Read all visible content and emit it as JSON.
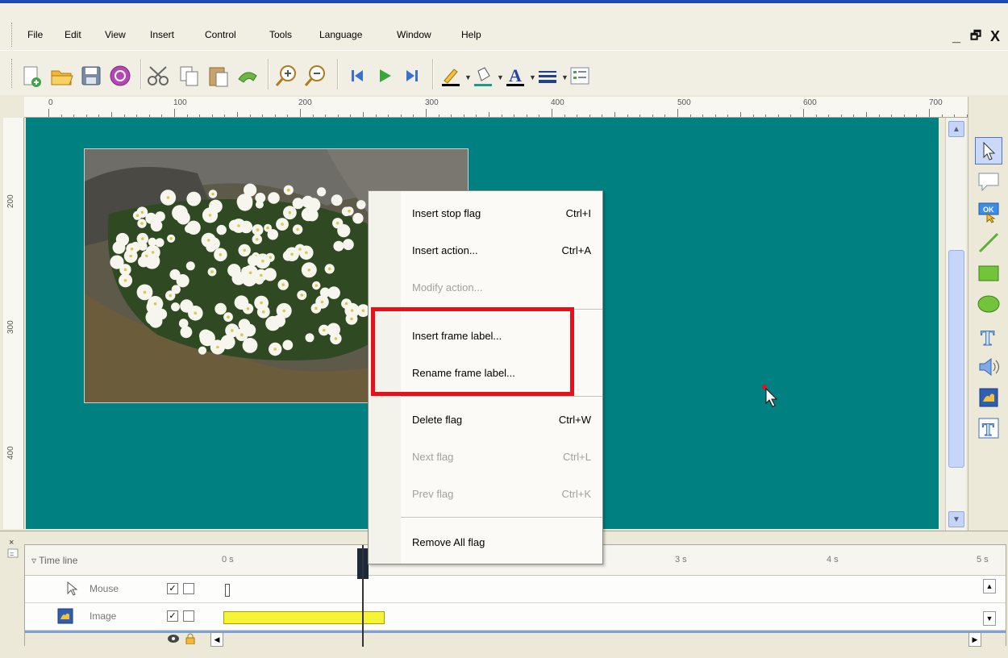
{
  "menubar": {
    "items": [
      "File",
      "Edit",
      "View",
      "Insert",
      "Control",
      "Tools",
      "Language",
      "Window",
      "Help"
    ],
    "window_controls": [
      "_",
      "🗗",
      "X"
    ]
  },
  "toolbar": {
    "icons": [
      "new-file-icon",
      "open-folder-icon",
      "save-icon",
      "publish-icon",
      "cut-icon",
      "copy-icon",
      "paste-icon",
      "undo-icon",
      "zoom-in-icon",
      "zoom-out-icon",
      "first-frame-icon",
      "play-icon",
      "last-frame-icon",
      "line-color-icon",
      "fill-color-icon",
      "font-color-icon",
      "line-style-icon",
      "properties-icon"
    ]
  },
  "ruler": {
    "horizontal": [
      "0",
      "100",
      "200",
      "300",
      "400",
      "500",
      "600",
      "700"
    ],
    "vertical": [
      "200",
      "300",
      "400"
    ]
  },
  "palette": {
    "tools": [
      "pointer-icon",
      "callout-icon",
      "button-icon",
      "line-icon",
      "rectangle-icon",
      "ellipse-icon",
      "text-icon",
      "sound-icon",
      "image-icon",
      "text-box-icon"
    ]
  },
  "context_menu": {
    "items": [
      {
        "label": "Insert stop flag",
        "shortcut": "Ctrl+I",
        "enabled": true
      },
      {
        "label": "Insert action...",
        "shortcut": "Ctrl+A",
        "enabled": true
      },
      {
        "label": "Modify action...",
        "shortcut": "",
        "enabled": false
      },
      {
        "label": "Insert frame label...",
        "shortcut": "",
        "enabled": true
      },
      {
        "label": "Rename frame label...",
        "shortcut": "",
        "enabled": true
      },
      {
        "label": "Delete flag",
        "shortcut": "Ctrl+W",
        "enabled": true
      },
      {
        "label": "Next flag",
        "shortcut": "Ctrl+L",
        "enabled": false
      },
      {
        "label": "Prev flag",
        "shortcut": "Ctrl+K",
        "enabled": false
      },
      {
        "label": "Remove All flag",
        "shortcut": "",
        "enabled": true
      }
    ]
  },
  "timeline": {
    "title": "Time line",
    "seconds": [
      "0 s",
      "3 s",
      "4 s",
      "5 s"
    ],
    "rows": [
      {
        "label": "Mouse",
        "visible": true
      },
      {
        "label": "Image",
        "visible": true
      }
    ]
  },
  "colors": {
    "canvas": "#008080",
    "highlight": "#e8101a",
    "timeline_bar": "#f7f336"
  }
}
